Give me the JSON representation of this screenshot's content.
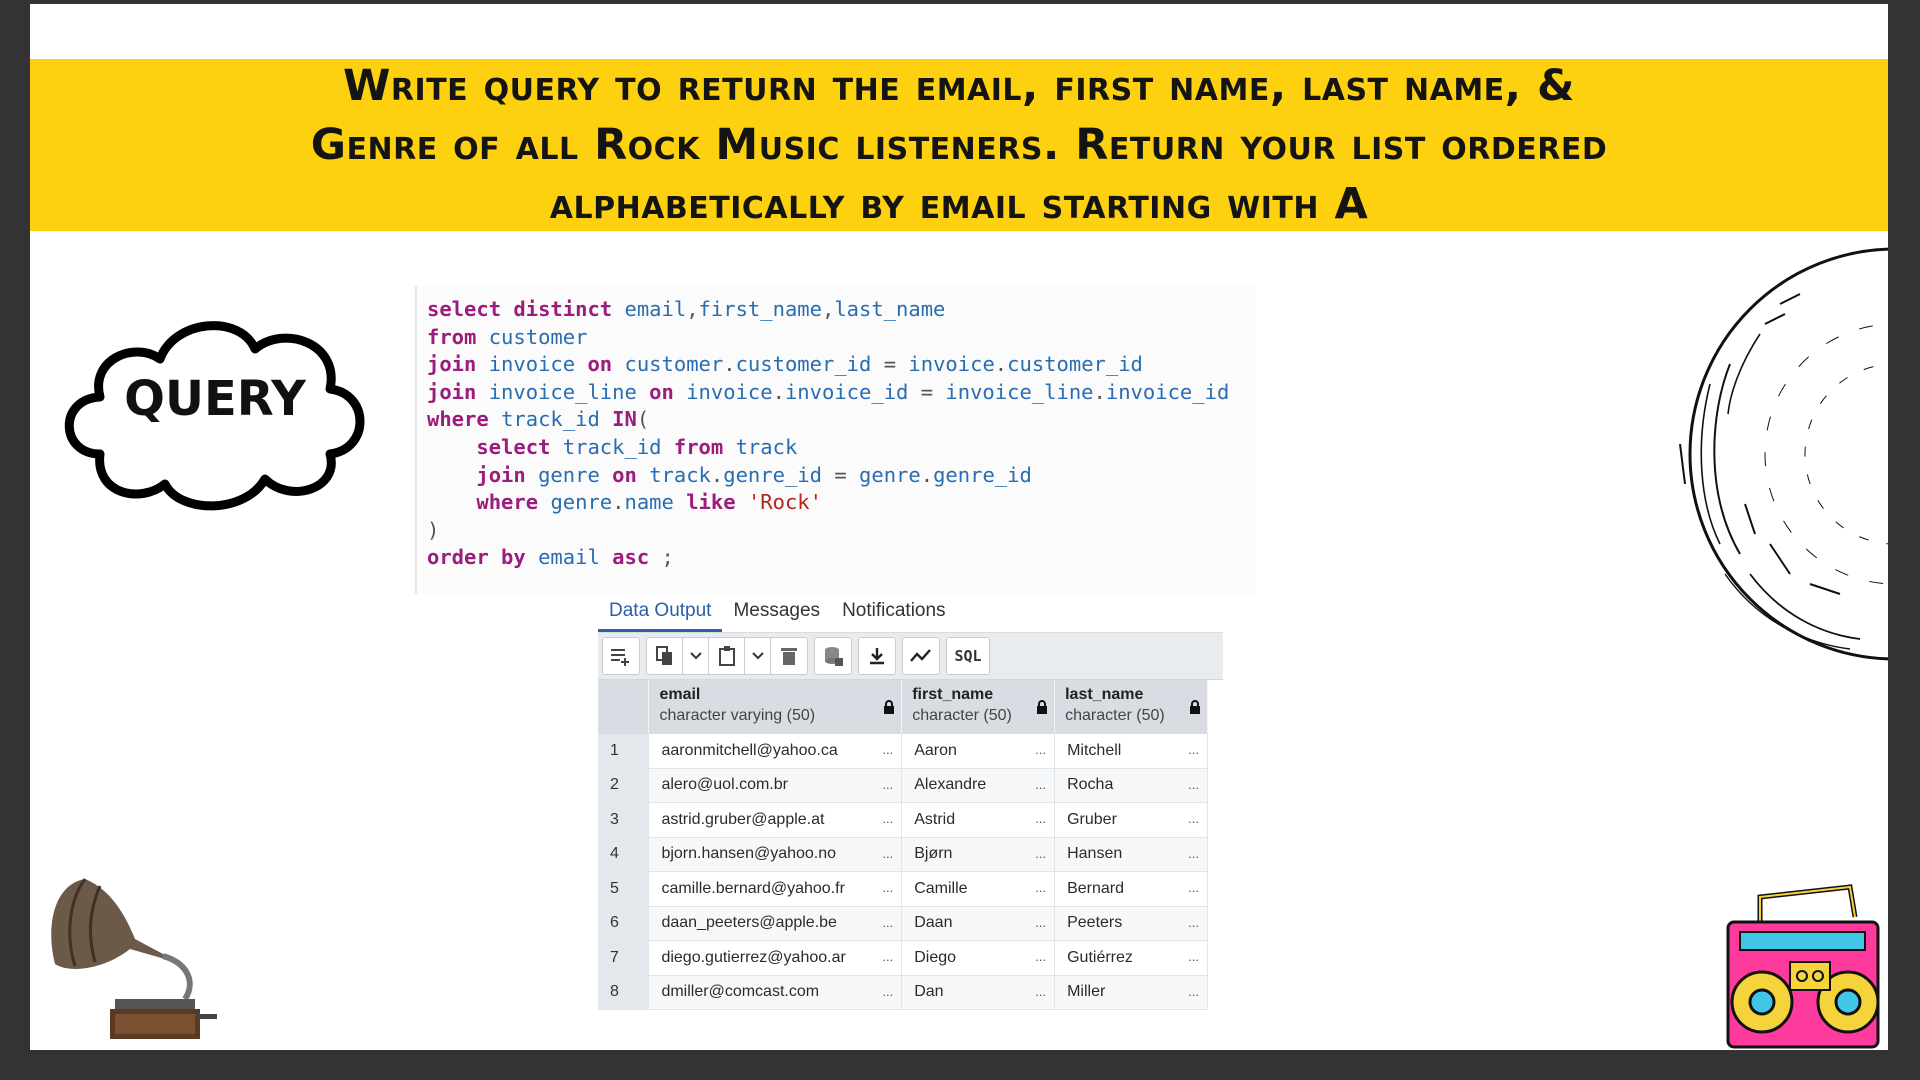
{
  "banner": {
    "question": "Write query to return the email, first name, last name, & Genre of all Rock Music listeners. Return your list ordered alphabetically by email starting with A"
  },
  "cloud": {
    "label": "QUERY"
  },
  "code": {
    "lines": [
      [
        [
          "kw",
          "select distinct "
        ],
        [
          "id",
          "email"
        ],
        [
          "pun",
          ","
        ],
        [
          "id",
          "first_name"
        ],
        [
          "pun",
          ","
        ],
        [
          "id",
          "last_name"
        ]
      ],
      [
        [
          "kw",
          "from "
        ],
        [
          "id",
          "customer"
        ]
      ],
      [
        [
          "kw",
          "join "
        ],
        [
          "id",
          "invoice "
        ],
        [
          "kw",
          "on "
        ],
        [
          "id",
          "customer"
        ],
        [
          "pun",
          "."
        ],
        [
          "id",
          "customer_id "
        ],
        [
          "pun",
          "= "
        ],
        [
          "id",
          "invoice"
        ],
        [
          "pun",
          "."
        ],
        [
          "id",
          "customer_id"
        ]
      ],
      [
        [
          "kw",
          "join "
        ],
        [
          "id",
          "invoice_line "
        ],
        [
          "kw",
          "on "
        ],
        [
          "id",
          "invoice"
        ],
        [
          "pun",
          "."
        ],
        [
          "id",
          "invoice_id "
        ],
        [
          "pun",
          "= "
        ],
        [
          "id",
          "invoice_line"
        ],
        [
          "pun",
          "."
        ],
        [
          "id",
          "invoice_id"
        ]
      ],
      [
        [
          "kw",
          "where "
        ],
        [
          "id",
          "track_id "
        ],
        [
          "kw",
          "IN"
        ],
        [
          "pun",
          "("
        ]
      ],
      [
        [
          "pun",
          "    "
        ],
        [
          "kw",
          "select "
        ],
        [
          "id",
          "track_id "
        ],
        [
          "kw",
          "from "
        ],
        [
          "id",
          "track"
        ]
      ],
      [
        [
          "pun",
          "    "
        ],
        [
          "kw",
          "join "
        ],
        [
          "id",
          "genre "
        ],
        [
          "kw",
          "on "
        ],
        [
          "id",
          "track"
        ],
        [
          "pun",
          "."
        ],
        [
          "id",
          "genre_id "
        ],
        [
          "pun",
          "= "
        ],
        [
          "id",
          "genre"
        ],
        [
          "pun",
          "."
        ],
        [
          "id",
          "genre_id"
        ]
      ],
      [
        [
          "pun",
          "    "
        ],
        [
          "kw",
          "where "
        ],
        [
          "id",
          "genre"
        ],
        [
          "pun",
          "."
        ],
        [
          "id",
          "name "
        ],
        [
          "kw",
          "like "
        ],
        [
          "str",
          "'Rock'"
        ]
      ],
      [
        [
          "pun",
          ")"
        ]
      ],
      [
        [
          "kw",
          "order by "
        ],
        [
          "id",
          "email "
        ],
        [
          "kw",
          "asc "
        ],
        [
          "pun",
          ";"
        ]
      ]
    ]
  },
  "tabs": [
    "Data Output",
    "Messages",
    "Notifications"
  ],
  "toolbar": {
    "sql_label": "SQL"
  },
  "grid": {
    "columns": [
      {
        "name": "email",
        "type": "character varying (50)"
      },
      {
        "name": "first_name",
        "type": "character (50)"
      },
      {
        "name": "last_name",
        "type": "character (50)"
      }
    ],
    "ellipsis": "...",
    "rows": [
      [
        "1",
        "aaronmitchell@yahoo.ca",
        "Aaron",
        "Mitchell"
      ],
      [
        "2",
        "alero@uol.com.br",
        "Alexandre",
        "Rocha"
      ],
      [
        "3",
        "astrid.gruber@apple.at",
        "Astrid",
        "Gruber"
      ],
      [
        "4",
        "bjorn.hansen@yahoo.no",
        "Bjørn",
        "Hansen"
      ],
      [
        "5",
        "camille.bernard@yahoo.fr",
        "Camille",
        "Bernard"
      ],
      [
        "6",
        "daan_peeters@apple.be",
        "Daan",
        "Peeters"
      ],
      [
        "7",
        "diego.gutierrez@yahoo.ar",
        "Diego",
        "Gutiérrez"
      ],
      [
        "8",
        "dmiller@comcast.com",
        "Dan",
        "Miller"
      ]
    ]
  },
  "icons": {
    "toolbar": [
      "add-row-icon",
      "copy-icon",
      "chevron-down-icon",
      "paste-icon",
      "chevron-down-icon",
      "delete-icon",
      "save-data-icon",
      "download-icon",
      "graph-icon",
      "sql-icon"
    ],
    "decor": [
      "cloud-icon",
      "vinyl-record-icon",
      "gramophone-icon",
      "boombox-icon",
      "lock-icon"
    ]
  }
}
